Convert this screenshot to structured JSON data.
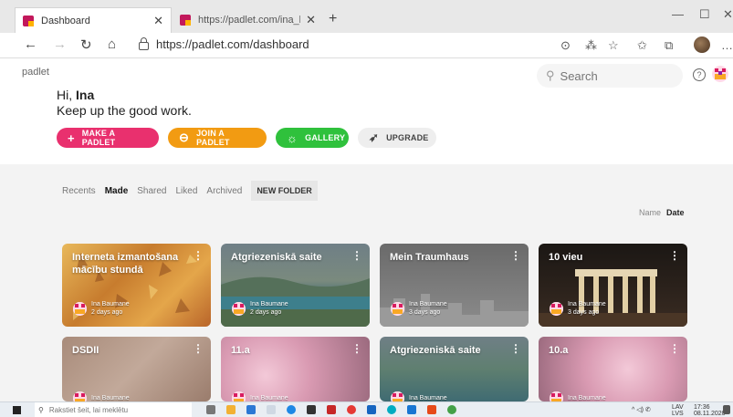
{
  "browser": {
    "tabs": [
      {
        "title": "Dashboard",
        "active": true
      },
      {
        "title": "https://padlet.com/ina_baumane",
        "active": false
      }
    ],
    "url": "https://padlet.com/dashboard"
  },
  "header": {
    "brand": "padlet",
    "search_placeholder": "Search",
    "help_label": "?"
  },
  "greeting": {
    "hi": "Hi,",
    "name": "Ina",
    "subtitle": "Keep up the good work."
  },
  "actions": {
    "make": "MAKE A PADLET",
    "join": "JOIN A PADLET",
    "gallery": "GALLERY",
    "upgrade": "UPGRADE"
  },
  "filters": [
    "Recents",
    "Made",
    "Shared",
    "Liked",
    "Archived"
  ],
  "active_filter": "Made",
  "new_folder": "NEW FOLDER",
  "sort": {
    "name": "Name",
    "date": "Date",
    "active": "Date"
  },
  "cards": [
    {
      "title": "Interneta izmantošana mācību stundā",
      "owner": "Ina Baumane",
      "time": "2 days ago"
    },
    {
      "title": "Atgriezeniskā saite",
      "owner": "Ina Baumane",
      "time": "2 days ago"
    },
    {
      "title": "Mein Traumhaus",
      "owner": "Ina Baumane",
      "time": "3 days ago"
    },
    {
      "title": "10 vieu",
      "owner": "Ina Baumane",
      "time": "3 days ago"
    },
    {
      "title": "DSDII",
      "owner": "Ina Baumane",
      "time": ""
    },
    {
      "title": "11.a",
      "owner": "Ina Baumane",
      "time": ""
    },
    {
      "title": "Atgriezeniskā saite",
      "owner": "Ina Baumane",
      "time": ""
    },
    {
      "title": "10.a",
      "owner": "Ina Baumane",
      "time": ""
    }
  ],
  "taskbar": {
    "search_placeholder": "Rakstiet šeit, lai meklētu",
    "lang_top": "LAV",
    "lang_bottom": "LVS",
    "time": "17:36",
    "date": "08.11.2020"
  },
  "colors": {
    "make": "#e9306e",
    "join": "#f29b12",
    "gallery": "#2fc13c"
  }
}
